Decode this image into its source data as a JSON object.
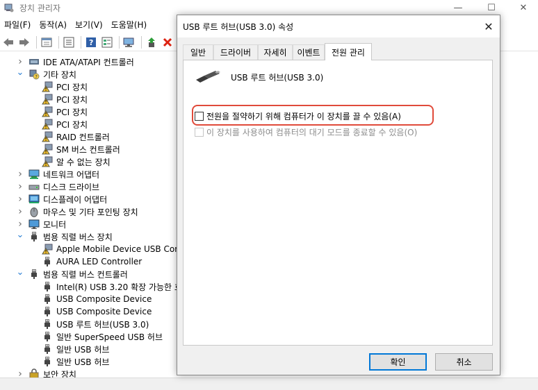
{
  "window": {
    "title": "장치 관리자",
    "minimize_glyph": "—",
    "maximize_glyph": "☐",
    "close_glyph": "✕"
  },
  "menu": {
    "items": [
      "파일(F)",
      "동작(A)",
      "보기(V)",
      "도움말(H)"
    ]
  },
  "toolbar": {
    "buttons": [
      "back-arrow-icon",
      "forward-arrow-icon",
      "properties-icon",
      "list-icon",
      "help-icon",
      "view-icon",
      "scan-icon",
      "update-driver-icon",
      "uninstall-icon"
    ]
  },
  "tree": {
    "items": [
      {
        "label": "IDE ATA/ATAPI 컨트롤러",
        "level": 1,
        "expander": "collapsed",
        "icon": "ide-controller-icon"
      },
      {
        "label": "기타 장치",
        "level": 1,
        "expander": "expanded",
        "icon": "other-devices-icon"
      },
      {
        "label": "PCI 장치",
        "level": 2,
        "icon": "warning-device-icon"
      },
      {
        "label": "PCI 장치",
        "level": 2,
        "icon": "warning-device-icon"
      },
      {
        "label": "PCI 장치",
        "level": 2,
        "icon": "warning-device-icon"
      },
      {
        "label": "PCI 장치",
        "level": 2,
        "icon": "warning-device-icon"
      },
      {
        "label": "RAID 컨트롤러",
        "level": 2,
        "icon": "warning-device-icon"
      },
      {
        "label": "SM 버스 컨트롤러",
        "level": 2,
        "icon": "warning-device-icon"
      },
      {
        "label": "알 수 없는 장치",
        "level": 2,
        "icon": "warning-device-icon"
      },
      {
        "label": "네트워크 어댑터",
        "level": 1,
        "expander": "collapsed",
        "icon": "network-adapter-icon"
      },
      {
        "label": "디스크 드라이브",
        "level": 1,
        "expander": "collapsed",
        "icon": "disk-drive-icon"
      },
      {
        "label": "디스플레이 어댑터",
        "level": 1,
        "expander": "collapsed",
        "icon": "display-adapter-icon"
      },
      {
        "label": "마우스 및 기타 포인팅 장치",
        "level": 1,
        "expander": "collapsed",
        "icon": "mouse-icon"
      },
      {
        "label": "모니터",
        "level": 1,
        "expander": "collapsed",
        "icon": "monitor-icon"
      },
      {
        "label": "범용 직렬 버스 장치",
        "level": 1,
        "expander": "expanded",
        "icon": "usb-plug-icon"
      },
      {
        "label": "Apple Mobile Device USB Comp",
        "level": 2,
        "icon": "warning-device-icon"
      },
      {
        "label": "AURA LED Controller",
        "level": 2,
        "icon": "usb-plug-icon"
      },
      {
        "label": "범용 직렬 버스 컨트롤러",
        "level": 1,
        "expander": "expanded",
        "icon": "usb-plug-icon"
      },
      {
        "label": "Intel(R) USB 3.20 확장 가능한 호",
        "level": 2,
        "icon": "usb-plug-icon"
      },
      {
        "label": "USB Composite Device",
        "level": 2,
        "icon": "usb-plug-icon"
      },
      {
        "label": "USB Composite Device",
        "level": 2,
        "icon": "usb-plug-icon"
      },
      {
        "label": "USB 루트 허브(USB 3.0)",
        "level": 2,
        "icon": "usb-plug-icon"
      },
      {
        "label": "일반 SuperSpeed USB 허브",
        "level": 2,
        "icon": "usb-plug-icon"
      },
      {
        "label": "일반 USB 허브",
        "level": 2,
        "icon": "usb-plug-icon"
      },
      {
        "label": "일반 USB 허브",
        "level": 2,
        "icon": "usb-plug-icon"
      },
      {
        "label": "보안 장치",
        "level": 1,
        "expander": "collapsed",
        "icon": "security-device-icon"
      }
    ]
  },
  "dialog": {
    "title": "USB 루트 허브(USB 3.0) 속성",
    "close_glyph": "✕",
    "tabs": [
      {
        "label": "일반",
        "active": false
      },
      {
        "label": "드라이버",
        "active": false
      },
      {
        "label": "자세히",
        "active": false
      },
      {
        "label": "이벤트",
        "active": false
      },
      {
        "label": "전원 관리",
        "active": true
      }
    ],
    "device_name": "USB 루트 허브(USB 3.0)",
    "option1": {
      "label": "전원을 절약하기 위해 컴퓨터가 이 장치를 끌 수 있음(A)",
      "checked": false,
      "enabled": true
    },
    "option2": {
      "label": "이 장치를 사용하여 컴퓨터의 대기 모드를 종료할 수 있음(O)",
      "checked": false,
      "enabled": false
    },
    "ok_label": "확인",
    "cancel_label": "취소"
  },
  "colors": {
    "highlight": "#e04a3a",
    "primary_button_border": "#0078d7",
    "warning": "#f2c12e"
  }
}
